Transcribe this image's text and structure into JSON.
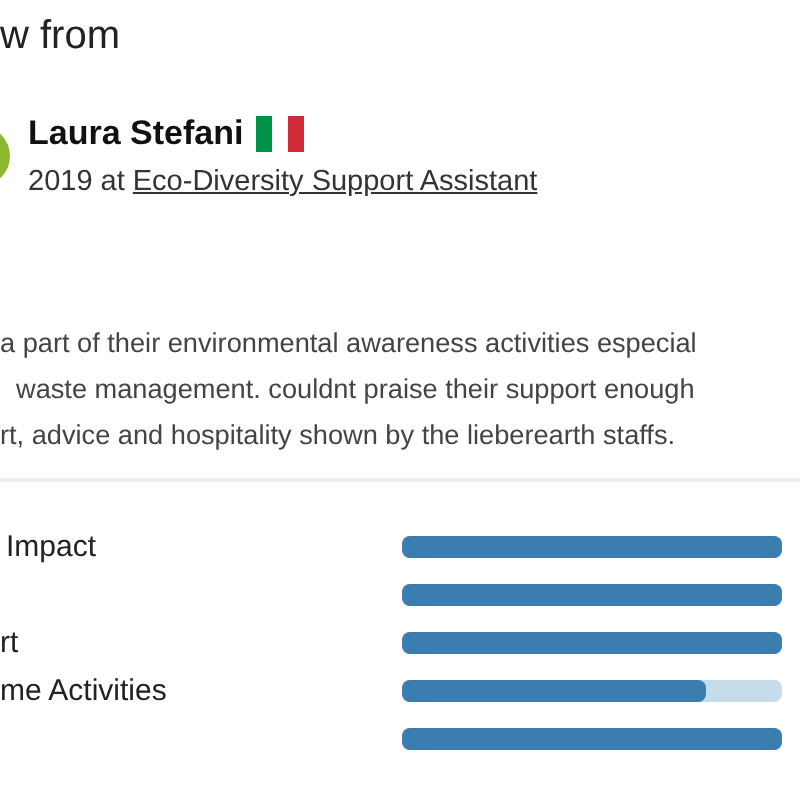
{
  "heading": "w from",
  "reviewer": {
    "name": "Laura Stefani",
    "year": "2019 at",
    "role": "Eco-Diversity Support Assistant"
  },
  "review_lines": [
    "a part of their environmental awareness activities especial",
    "waste management. couldnt praise their support enough",
    "rt, advice and hospitality shown by the lieberearth staffs."
  ],
  "ratings": [
    {
      "label": "Impact",
      "level": 1
    },
    {
      "level": 1
    },
    {
      "label": "rt",
      "level": 1
    },
    {
      "label": "me Activities",
      "level": 0.8
    },
    {
      "level": 1
    }
  ]
}
